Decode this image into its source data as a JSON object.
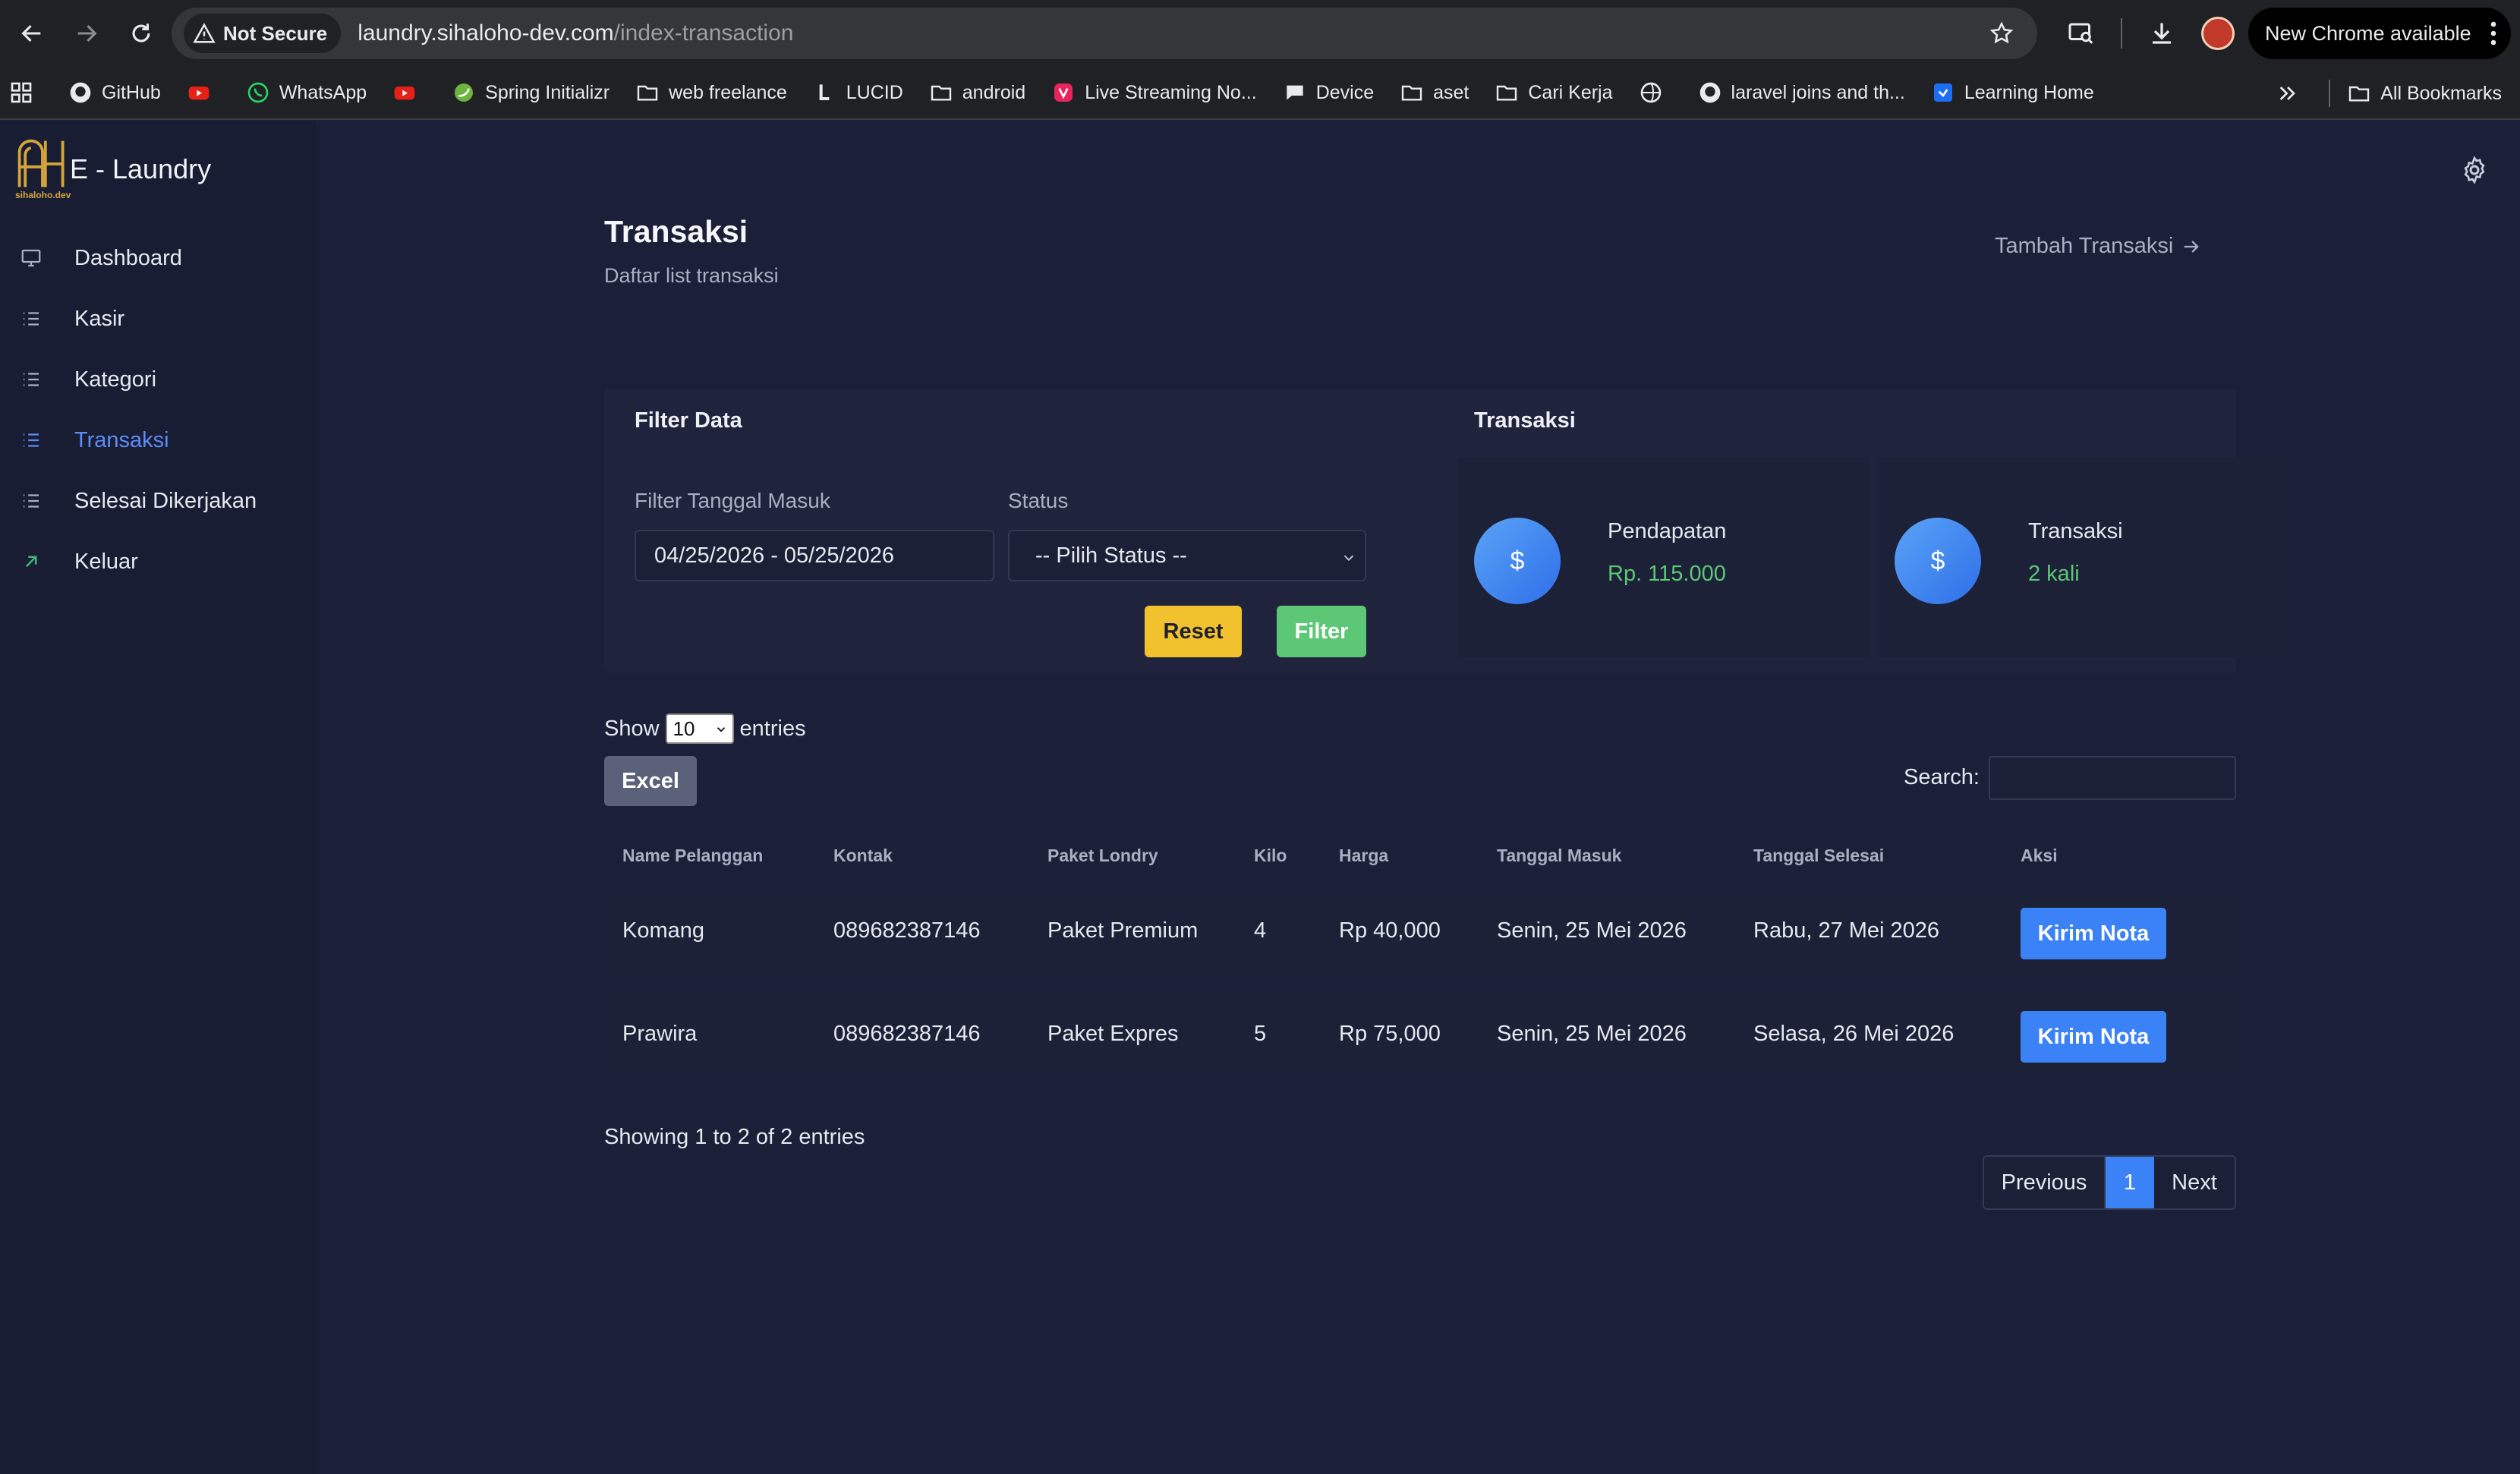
{
  "browser": {
    "security_label": "Not Secure",
    "url_host": "laundry.sihaloho-dev.com",
    "url_path": "/index-transaction",
    "update_label": "New Chrome available",
    "bookmarks": [
      {
        "label": "GitHub",
        "icon": "github-icon"
      },
      {
        "label": "",
        "icon": "youtube-icon"
      },
      {
        "label": "WhatsApp",
        "icon": "whatsapp-icon"
      },
      {
        "label": "",
        "icon": "youtube-icon"
      },
      {
        "label": "Spring Initializr",
        "icon": "spring-icon"
      },
      {
        "label": "web freelance",
        "icon": "folder-icon"
      },
      {
        "label": "LUCID",
        "icon": "lucid-icon"
      },
      {
        "label": "android",
        "icon": "folder-icon"
      },
      {
        "label": "Live Streaming No...",
        "icon": "vivo-icon"
      },
      {
        "label": "Device",
        "icon": "device-icon"
      },
      {
        "label": "aset",
        "icon": "folder-icon"
      },
      {
        "label": "Cari Kerja",
        "icon": "folder-icon"
      },
      {
        "label": "",
        "icon": "globe-icon"
      },
      {
        "label": "laravel joins and th...",
        "icon": "github-icon"
      },
      {
        "label": "Learning Home",
        "icon": "learning-icon"
      }
    ],
    "all_bookmarks_label": "All Bookmarks"
  },
  "sidebar": {
    "brand_sub": "sihaloho.dev",
    "brand_name": "E - Laundry",
    "items": [
      {
        "label": "Dashboard",
        "icon": "monitor-icon",
        "active": false
      },
      {
        "label": "Kasir",
        "icon": "list-icon",
        "active": false
      },
      {
        "label": "Kategori",
        "icon": "list-icon",
        "active": false
      },
      {
        "label": "Transaksi",
        "icon": "list-icon",
        "active": true
      },
      {
        "label": "Selesai Dikerjakan",
        "icon": "list-icon",
        "active": false
      },
      {
        "label": "Keluar",
        "icon": "arrow-up-right-icon",
        "active": false
      }
    ]
  },
  "header": {
    "title": "Transaksi",
    "subtitle": "Daftar list transaksi",
    "add_link": "Tambah Transaksi"
  },
  "filter": {
    "title": "Filter Data",
    "date_label": "Filter Tanggal Masuk",
    "date_value": "04/25/2026 - 05/25/2026",
    "status_label": "Status",
    "status_value": "-- Pilih Status --",
    "reset_label": "Reset",
    "filter_label": "Filter"
  },
  "stats": {
    "title": "Transaksi",
    "cards": [
      {
        "icon": "dollar-icon",
        "symbol": "$",
        "label": "Pendapatan",
        "value": "Rp. 115.000"
      },
      {
        "icon": "dollar-icon",
        "symbol": "$",
        "label": "Transaksi",
        "value": "2 kali"
      }
    ]
  },
  "table_controls": {
    "show_label": "Show",
    "entries_value": "10",
    "entries_label": "entries",
    "excel_label": "Excel",
    "search_label": "Search:"
  },
  "table": {
    "headers": [
      "Name Pelanggan",
      "Kontak",
      "Paket Londry",
      "Kilo",
      "Harga",
      "Tanggal Masuk",
      "Tanggal Selesai",
      "Aksi"
    ],
    "rows": [
      {
        "name": "Komang",
        "kontak": "089682387146",
        "paket": "Paket Premium",
        "kilo": "4",
        "harga": "Rp 40,000",
        "masuk": "Senin, 25 Mei 2026",
        "selesai": "Rabu, 27 Mei 2026",
        "action": "Kirim Nota"
      },
      {
        "name": "Prawira",
        "kontak": "089682387146",
        "paket": "Paket Expres",
        "kilo": "5",
        "harga": "Rp 75,000",
        "masuk": "Senin, 25 Mei 2026",
        "selesai": "Selasa, 26 Mei 2026",
        "action": "Kirim Nota"
      }
    ]
  },
  "footer": {
    "showing": "Showing 1 to 2 of 2 entries",
    "prev": "Previous",
    "current_page": "1",
    "next": "Next"
  },
  "colors": {
    "background": "#1b2038",
    "sidebar": "#191d33",
    "accent": "#3b82f6",
    "active_menu": "#5b8cf5",
    "success": "#5cc775",
    "warning": "#f2c12e"
  }
}
